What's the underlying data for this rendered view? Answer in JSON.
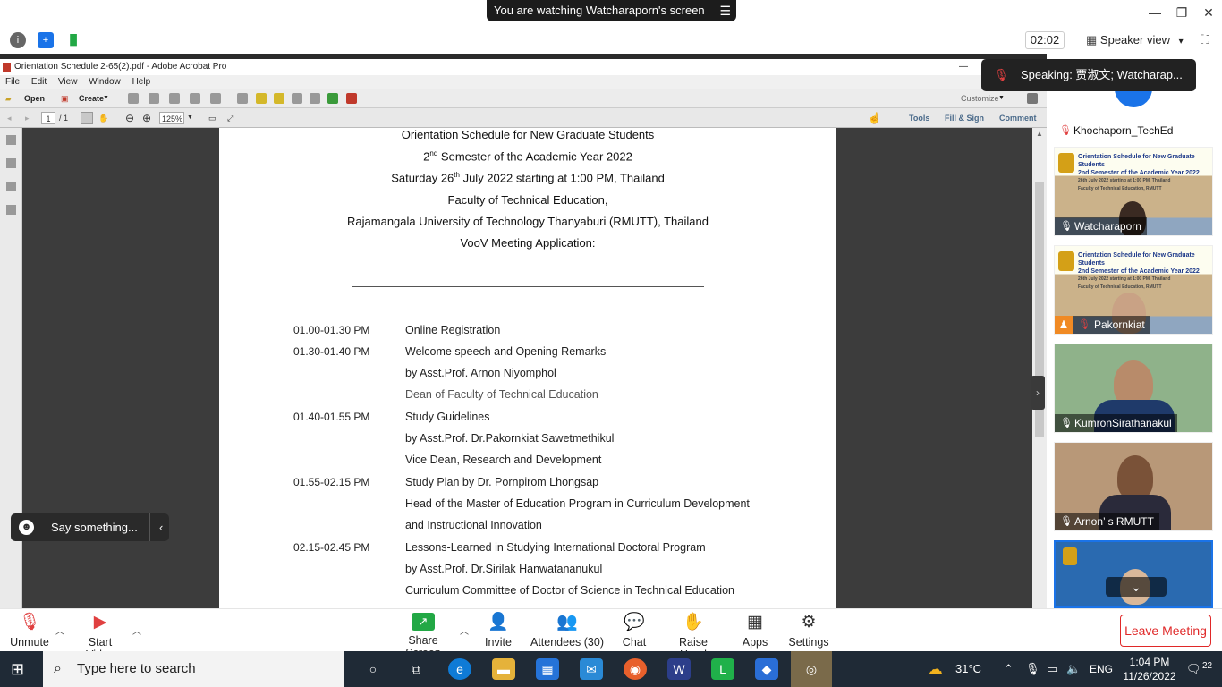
{
  "banner": {
    "text": "You are watching Watcharaporn's screen",
    "menu_icon": "menu-icon"
  },
  "topbar": {
    "timer": "02:02",
    "view_label": "Speaker view",
    "view_caret": "▾"
  },
  "acrobat": {
    "title": "Orientation Schedule 2-65(2).pdf - Adobe Acrobat Pro",
    "menu": [
      "File",
      "Edit",
      "View",
      "Window",
      "Help"
    ],
    "toolbar": {
      "open": "Open",
      "create": "Create",
      "customize": "Customize"
    },
    "nav": {
      "page": "1",
      "of": "/ 1",
      "zoom": "125%",
      "tools": "Tools",
      "fill_sign": "Fill & Sign",
      "comment": "Comment"
    }
  },
  "document": {
    "heading_lines": [
      "Orientation Schedule for New Graduate Students",
      "Semester of the Academic Year 2022",
      "Faculty of Technical Education,",
      "Rajamangala University of Technology Thanyaburi (RMUTT), Thailand",
      "VooV Meeting Application:"
    ],
    "semester_num": "2",
    "semester_sup": "nd",
    "date_pre": "Saturday 26",
    "date_sup": "th",
    "date_post": " July 2022 starting at 1:00 PM, Thailand",
    "schedule": [
      {
        "time": "01.00-01.30 PM",
        "lines": [
          "Online Registration"
        ]
      },
      {
        "time": "01.30-01.40 PM",
        "lines": [
          "Welcome speech and Opening Remarks",
          "by Asst.Prof. Arnon  Niyomphol",
          "Dean of Faculty of Technical Education"
        ]
      },
      {
        "time": "01.40-01.55 PM",
        "lines": [
          "Study Guidelines",
          "by Asst.Prof. Dr.Pakornkiat Sawetmethikul",
          "Vice Dean, Research and Development"
        ]
      },
      {
        "time": "01.55-02.15 PM",
        "lines": [
          "Study Plan by Dr. Pornpirom Lhongsap",
          "Head of the Master of Education Program in Curriculum Development",
          "and Instructional Innovation"
        ]
      },
      {
        "time": "02.15-02.45 PM",
        "lines": [
          "Lessons-Learned in Studying International Doctoral Program",
          "by Asst.Prof. Dr.Sirilak  Hanwatananukul",
          "Curriculum Committee of Doctor of Science in Technical Education"
        ]
      }
    ]
  },
  "chat_pill": {
    "text": "Say something..."
  },
  "speaking": {
    "text": "Speaking: 贾淑文; Watcharap..."
  },
  "gallery": {
    "tiles": [
      {
        "name": "Khochaporn_TechEd"
      },
      {
        "name": "Watcharaporn",
        "slide": [
          "Orientation Schedule for New Graduate Students",
          "2nd Semester of the Academic Year 2022",
          "26th July 2022 starting at 1:00 PM, Thailand",
          "Faculty of Technical Education, RMUTT"
        ]
      },
      {
        "name": "Pakornkiat",
        "slide": [
          "Orientation Schedule for New Graduate Students",
          "2nd Semester of the Academic Year 2022",
          "26th July 2022 starting at 1:00 PM, Thailand",
          "Faculty of Technical Education, RMUTT"
        ]
      },
      {
        "name": "KumronSirathanakul"
      },
      {
        "name": "Arnon’ s RMUTT"
      }
    ]
  },
  "controls": {
    "unmute": "Unmute",
    "start_video": "Start Video",
    "share_screen": "Share Screen",
    "invite": "Invite",
    "attendees": "Attendees (30)",
    "chat": "Chat",
    "raise_hand": "Raise Hand",
    "apps": "Apps",
    "settings": "Settings",
    "leave": "Leave Meeting"
  },
  "taskbar": {
    "search_placeholder": "Type here to search",
    "weather": "31°C",
    "lang": "ENG",
    "time": "1:04 PM",
    "date": "11/26/2022",
    "notifications": "22"
  }
}
